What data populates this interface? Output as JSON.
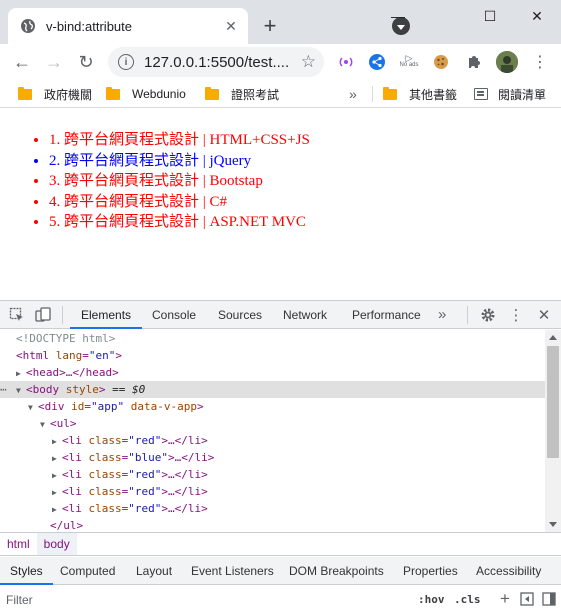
{
  "tab": {
    "title": "v-bind:attribute",
    "favicon": "globe-icon"
  },
  "window": {
    "minimize": "—",
    "maximize": "☐",
    "close": "✕"
  },
  "toolbar": {
    "url": "127.0.0.1:5500/test....",
    "back": "←",
    "forward": "→",
    "reload": "↻",
    "extensions": [
      "podcast-icon",
      "share-icon",
      "no-ads-icon",
      "cookie-icon",
      "puzzle-icon",
      "avatar"
    ],
    "no_ads_label": "No ads",
    "menu": "⋮"
  },
  "bookmarks": {
    "items": [
      "政府機關",
      "Webdunio",
      "證照考試"
    ],
    "overflow": "»",
    "other": "其他書籤",
    "reading_list": "閱讀清單"
  },
  "page": {
    "items": [
      {
        "text": "1. 跨平台網頁程式設計 | HTML+CSS+JS",
        "class": "red"
      },
      {
        "text": "2. 跨平台網頁程式設計 | jQuery",
        "class": "blue"
      },
      {
        "text": "3. 跨平台網頁程式設計 | Bootstap",
        "class": "red"
      },
      {
        "text": "4. 跨平台網頁程式設計 | C#",
        "class": "red"
      },
      {
        "text": "5. 跨平台網頁程式設計 | ASP.NET MVC",
        "class": "red"
      }
    ]
  },
  "devtools": {
    "tabs": [
      "Elements",
      "Console",
      "Sources",
      "Network",
      "Performance"
    ],
    "more": "»",
    "dom": {
      "doctype": "<!DOCTYPE html>",
      "html_open": "<html",
      "html_attr": "lang",
      "html_val": "\"en\"",
      "head": "<head>…</head>",
      "body_tag": "<body",
      "body_attr": "style",
      "body_eq": "== $0",
      "div_tag": "<div",
      "div_attr1": "id",
      "div_val1": "\"app\"",
      "div_attr2": "data-v-app",
      "ul_open": "<ul>",
      "li_attr": "class",
      "li_classes": [
        "\"red\"",
        "\"blue\"",
        "\"red\"",
        "\"red\"",
        "\"red\""
      ],
      "li_tag": "<li",
      "li_end": "…</li>",
      "ul_close": "</ul>",
      "gt": ">"
    },
    "breadcrumbs": [
      "html",
      "body"
    ],
    "subtabs": [
      "Styles",
      "Computed",
      "Layout",
      "Event Listeners",
      "DOM Breakpoints",
      "Properties",
      "Accessibility"
    ],
    "filter_placeholder": "Filter",
    "hov": ":hov",
    "cls": ".cls",
    "plus": "+"
  }
}
